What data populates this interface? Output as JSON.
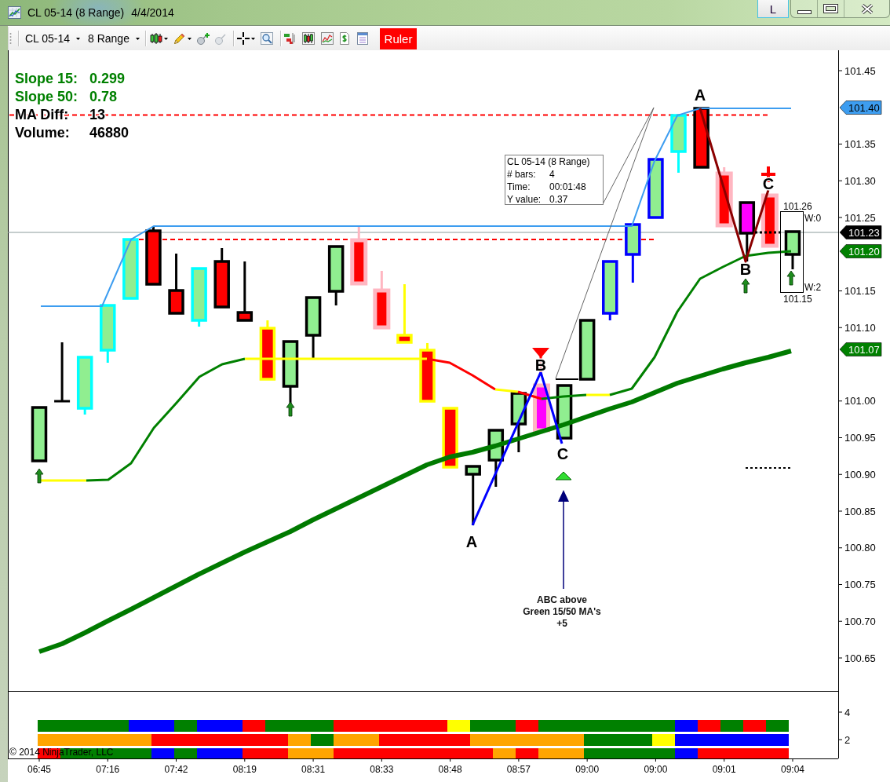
{
  "window": {
    "title": "CL 05-14 (8 Range)",
    "date": "4/4/2014",
    "link_button": "L"
  },
  "toolbar": {
    "instrument": "CL 05-14",
    "period": "8 Range",
    "ruler": {
      "label": "Ruler",
      "active": true
    }
  },
  "stats": [
    {
      "label": "Slope 15:",
      "value": "0.299",
      "color": "#008000"
    },
    {
      "label": "Slope 50:",
      "value": "0.78",
      "color": "#008000"
    },
    {
      "label": "MA Diff:",
      "value": "13",
      "color": "#000000"
    },
    {
      "label": "Volume:",
      "value": "46880",
      "color": "#000000"
    }
  ],
  "ruler_info": {
    "title": "CL 05-14 (8 Range)",
    "rows": [
      {
        "label": "# bars:",
        "value": "4"
      },
      {
        "label": "Time:",
        "value": "00:01:48"
      },
      {
        "label": "Y value:",
        "value": "0.37"
      }
    ]
  },
  "abc_patterns": [
    {
      "labels": [
        "A",
        "B",
        "C"
      ],
      "color": "#0000ff"
    },
    {
      "labels": [
        "A",
        "B",
        "C"
      ],
      "color": "#8b0000"
    }
  ],
  "annotation": {
    "lines": [
      "ABC above",
      "Green 15/50 MA's",
      "+5"
    ]
  },
  "range_box": {
    "high": "101.26",
    "low": "101.15",
    "top_label": "W:0",
    "bottom_label": "W:2"
  },
  "price_axis": {
    "ticks": [
      "101.45",
      "101.35",
      "101.30",
      "101.25",
      "101.15",
      "101.10",
      "101.00",
      "100.95",
      "100.90",
      "100.85",
      "100.80",
      "100.75",
      "100.70",
      "100.65"
    ],
    "tags": [
      {
        "text": "101.40",
        "color": "#3d9df0"
      },
      {
        "text": "101.23",
        "color": "#000000"
      },
      {
        "text": "101.20",
        "color": "#008000"
      },
      {
        "text": "101.07",
        "color": "#008000"
      }
    ]
  },
  "indicator_panel": {
    "axis_labels": [
      "4",
      "2"
    ],
    "rows": [
      {
        "cells": [
          {
            "color": "#008000"
          },
          {
            "color": "#008000"
          },
          {
            "color": "#008000"
          },
          {
            "color": "#008000"
          },
          {
            "color": "#0000ff"
          },
          {
            "color": "#0000ff"
          },
          {
            "color": "#008000"
          },
          {
            "color": "#0000ff"
          },
          {
            "color": "#0000ff"
          },
          {
            "color": "#ff0000"
          },
          {
            "color": "#008000"
          },
          {
            "color": "#008000"
          },
          {
            "color": "#008000"
          },
          {
            "color": "#ff0000"
          },
          {
            "color": "#ff0000"
          },
          {
            "color": "#ff0000"
          },
          {
            "color": "#ff0000"
          },
          {
            "color": "#ff0000"
          },
          {
            "color": "#ffff00"
          },
          {
            "color": "#008000"
          },
          {
            "color": "#008000"
          },
          {
            "color": "#ff0000"
          },
          {
            "color": "#008000"
          },
          {
            "color": "#008000"
          },
          {
            "color": "#008000"
          },
          {
            "color": "#008000"
          },
          {
            "color": "#008000"
          },
          {
            "color": "#008000"
          },
          {
            "color": "#0000ff"
          },
          {
            "color": "#ff0000"
          },
          {
            "color": "#008000"
          },
          {
            "color": "#ff0000"
          },
          {
            "color": "#008000"
          }
        ]
      },
      {
        "cells": [
          {
            "color": "#ffa500"
          },
          {
            "color": "#ffa500"
          },
          {
            "color": "#ffa500"
          },
          {
            "color": "#ffa500"
          },
          {
            "color": "#ffa500"
          },
          {
            "color": "#ff0000"
          },
          {
            "color": "#ff0000"
          },
          {
            "color": "#ff0000"
          },
          {
            "color": "#ff0000"
          },
          {
            "color": "#ff0000"
          },
          {
            "color": "#ff0000"
          },
          {
            "color": "#ffa500"
          },
          {
            "color": "#008000"
          },
          {
            "color": "#ffa500"
          },
          {
            "color": "#ffa500"
          },
          {
            "color": "#ff0000"
          },
          {
            "color": "#ff0000"
          },
          {
            "color": "#ff0000"
          },
          {
            "color": "#ff0000"
          },
          {
            "color": "#ffa500"
          },
          {
            "color": "#ffa500"
          },
          {
            "color": "#ffa500"
          },
          {
            "color": "#ffa500"
          },
          {
            "color": "#ffa500"
          },
          {
            "color": "#008000"
          },
          {
            "color": "#008000"
          },
          {
            "color": "#008000"
          },
          {
            "color": "#ffff00"
          },
          {
            "color": "#0000ff"
          },
          {
            "color": "#0000ff"
          },
          {
            "color": "#0000ff"
          },
          {
            "color": "#0000ff"
          },
          {
            "color": "#0000ff"
          }
        ]
      },
      {
        "cells": [
          {
            "color": "#ff0000"
          },
          {
            "color": "#008000"
          },
          {
            "color": "#008000"
          },
          {
            "color": "#008000"
          },
          {
            "color": "#008000"
          },
          {
            "color": "#0000ff"
          },
          {
            "color": "#008000"
          },
          {
            "color": "#0000ff"
          },
          {
            "color": "#0000ff"
          },
          {
            "color": "#ff0000"
          },
          {
            "color": "#ff0000"
          },
          {
            "color": "#ffa500"
          },
          {
            "color": "#ffa500"
          },
          {
            "color": "#ff0000"
          },
          {
            "color": "#ff0000"
          },
          {
            "color": "#ff0000"
          },
          {
            "color": "#ff0000"
          },
          {
            "color": "#ff0000"
          },
          {
            "color": "#ff0000"
          },
          {
            "color": "#ff0000"
          },
          {
            "color": "#ffa500"
          },
          {
            "color": "#ff0000"
          },
          {
            "color": "#ffa500"
          },
          {
            "color": "#ffa500"
          },
          {
            "color": "#008000"
          },
          {
            "color": "#008000"
          },
          {
            "color": "#008000"
          },
          {
            "color": "#008000"
          },
          {
            "color": "#0000ff"
          },
          {
            "color": "#ff0000"
          },
          {
            "color": "#ff0000"
          },
          {
            "color": "#ff0000"
          },
          {
            "color": "#ff0000"
          }
        ]
      }
    ]
  },
  "time_axis": {
    "labels": [
      "06:45",
      "07:16",
      "07:42",
      "08:19",
      "08:31",
      "08:33",
      "08:48",
      "08:57",
      "09:00",
      "09:00",
      "09:01",
      "09:04"
    ]
  },
  "copyright": "© 2014 NinjaTrader, LLC"
}
